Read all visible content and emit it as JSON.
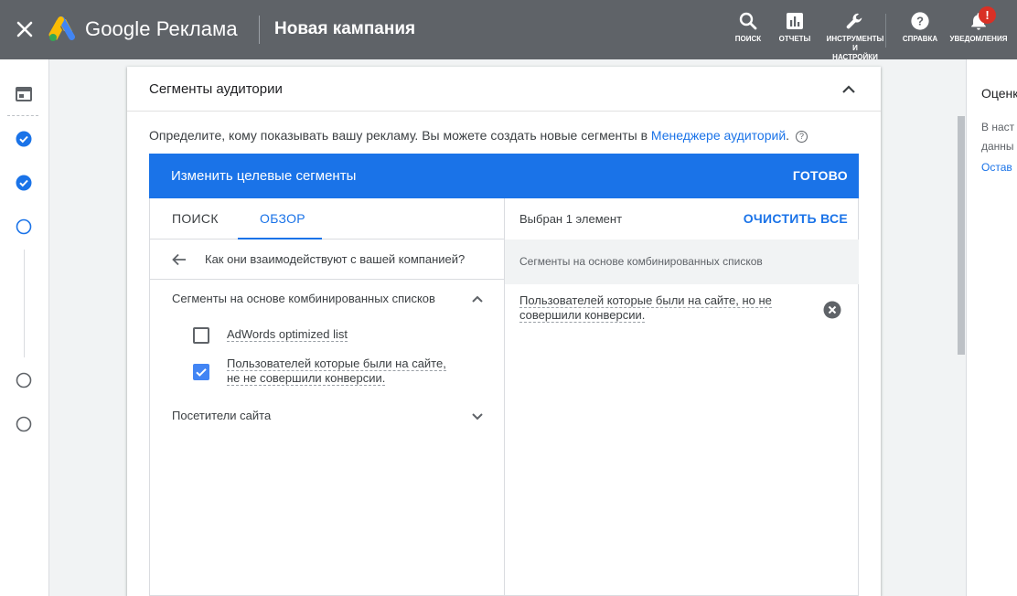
{
  "header": {
    "brand": "Google Реклама",
    "campaign_title": "Новая кампания",
    "tools": [
      {
        "icon": "search-icon",
        "label": "ПОИСК"
      },
      {
        "icon": "reports-icon",
        "label": "ОТЧЕТЫ"
      },
      {
        "icon": "wrench-icon",
        "label_lines": [
          "ИНСТРУМЕНТЫ",
          "И",
          "НАСТРОЙКИ"
        ]
      },
      {
        "icon": "help-icon",
        "label": "СПРАВКА"
      },
      {
        "icon": "bell-icon",
        "label": "УВЕДОМЛЕНИЯ",
        "badge": "!"
      }
    ]
  },
  "card": {
    "title": "Сегменты аудитории",
    "description": "Определите, кому показывать вашу рекламу.  Вы можете создать новые сегменты в ",
    "description_link": "Менеджере аудиторий",
    "description_end": ".",
    "help_glyph": "?"
  },
  "editor": {
    "title": "Изменить целевые сегменты",
    "done": "ГОТОВО",
    "tabs": [
      "ПОИСК",
      "ОБЗОР"
    ],
    "active_tab": "ОБЗОР",
    "back_question": "Как они взаимодействуют с вашей компанией?",
    "groups": [
      {
        "label": "Сегменты на основе комбинированных списков",
        "expanded": true,
        "items": [
          {
            "label": "AdWords optimized list",
            "checked": false
          },
          {
            "label_lines": [
              "Пользователей которые были на сайте,",
              "не не совершили конверсии."
            ],
            "checked": true
          }
        ]
      },
      {
        "label": "Посетители сайта",
        "expanded": false
      }
    ],
    "selected": {
      "count_label": "Выбран 1 элемент",
      "clear_all": "ОЧИСТИТЬ ВСЕ",
      "group": "Сегменты на основе комбинированных списков",
      "item_lines": [
        "Пользователей которые были на сайте, но не",
        "совершили конверсии."
      ]
    }
  },
  "right_panel": {
    "title": "Оценка",
    "text_lines": [
      "В наст",
      "данны"
    ],
    "link": "Остав"
  },
  "colors": {
    "accent": "#1a73e8",
    "topbar": "#5f6368",
    "badge": "#d93025"
  }
}
